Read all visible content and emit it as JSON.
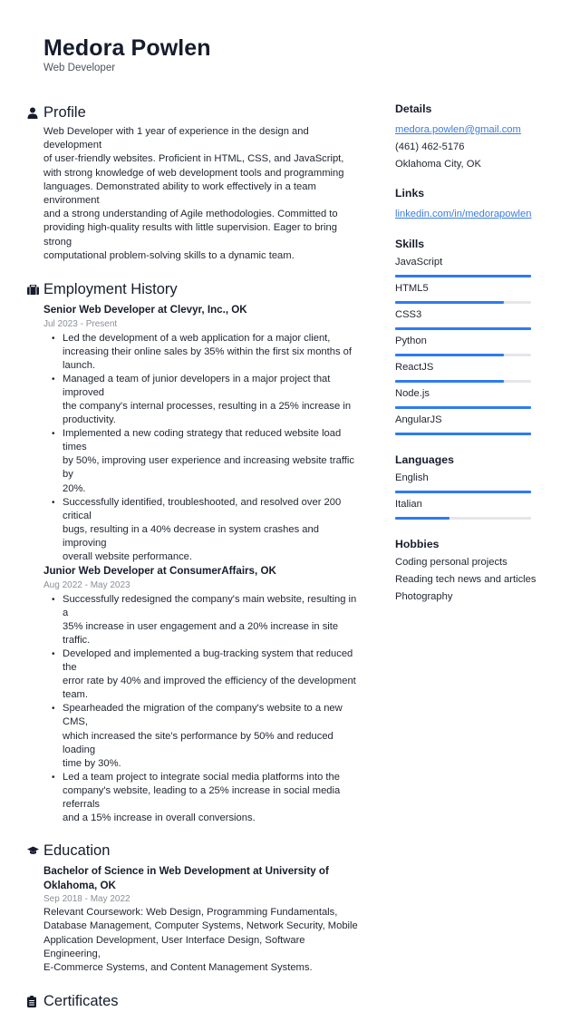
{
  "header": {
    "name": "Medora Powlen",
    "title": "Web Developer"
  },
  "profile": {
    "heading": "Profile",
    "icon": "person-icon",
    "lines": [
      "Web Developer with 1 year of experience in the design and development",
      "of user-friendly websites. Proficient in HTML, CSS, and JavaScript,",
      "with strong knowledge of web development tools and programming",
      "languages. Demonstrated ability to work effectively in a team environment",
      "and a strong understanding of Agile methodologies. Committed to",
      "providing high-quality results with little supervision. Eager to bring strong",
      "computational problem-solving skills to a dynamic team."
    ]
  },
  "employment": {
    "heading": "Employment History",
    "icon": "briefcase-icon",
    "jobs": [
      {
        "title": "Senior Web Developer at Clevyr, Inc., OK",
        "dates": "Jul 2023 - Present",
        "bullets": [
          [
            "Led the development of a web application for a major client,",
            "increasing their online sales by 35% within the first six months of",
            "launch."
          ],
          [
            "Managed a team of junior developers in a major project that improved",
            "the company's internal processes, resulting in a 25% increase in",
            "productivity."
          ],
          [
            "Implemented a new coding strategy that reduced website load times",
            "by 50%, improving user experience and increasing website traffic by",
            "20%."
          ],
          [
            "Successfully identified, troubleshooted, and resolved over 200 critical",
            "bugs, resulting in a 40% decrease in system crashes and improving",
            "overall website performance."
          ]
        ]
      },
      {
        "title": "Junior Web Developer at ConsumerAffairs, OK",
        "dates": "Aug 2022 - May 2023",
        "bullets": [
          [
            "Successfully redesigned the company's main website, resulting in a",
            "35% increase in user engagement and a 20% increase in site traffic."
          ],
          [
            "Developed and implemented a bug-tracking system that reduced the",
            "error rate by 40% and improved the efficiency of the development",
            "team."
          ],
          [
            "Spearheaded the migration of the company's website to a new CMS,",
            "which increased the site's performance by 50% and reduced loading",
            "time by 30%."
          ],
          [
            "Led a team project to integrate social media platforms into the",
            "company's website, leading to a 25% increase in social media referrals",
            "and a 15% increase in overall conversions."
          ]
        ]
      }
    ]
  },
  "education": {
    "heading": "Education",
    "icon": "graduation-cap-icon",
    "degree_lines": [
      "Bachelor of Science in Web Development at University of",
      "Oklahoma, OK"
    ],
    "dates": "Sep 2018 - May 2022",
    "lines": [
      "Relevant Coursework: Web Design, Programming Fundamentals,",
      "Database Management, Computer Systems, Network Security, Mobile",
      "Application Development, User Interface Design, Software Engineering,",
      "E-Commerce Systems, and Content Management Systems."
    ]
  },
  "certificates": {
    "heading": "Certificates",
    "icon": "clipboard-icon"
  },
  "details": {
    "heading": "Details",
    "email": "medora.powlen@gmail.com",
    "phone": "(461) 462-5176",
    "location": "Oklahoma City, OK"
  },
  "links": {
    "heading": "Links",
    "items": [
      "linkedin.com/in/medorapowlen"
    ]
  },
  "skills": {
    "heading": "Skills",
    "items": [
      {
        "name": "JavaScript",
        "level": 1.0
      },
      {
        "name": "HTML5",
        "level": 0.8
      },
      {
        "name": "CSS3",
        "level": 1.0
      },
      {
        "name": "Python",
        "level": 0.8
      },
      {
        "name": "ReactJS",
        "level": 0.8
      },
      {
        "name": "Node.js",
        "level": 1.0
      },
      {
        "name": "AngularJS",
        "level": 1.0
      }
    ]
  },
  "languages": {
    "heading": "Languages",
    "items": [
      {
        "name": "English",
        "level": 1.0
      },
      {
        "name": "Italian",
        "level": 0.4
      }
    ]
  },
  "hobbies": {
    "heading": "Hobbies",
    "items": [
      "Coding personal projects",
      "Reading tech news and articles",
      "Photography"
    ]
  },
  "colors": {
    "accent": "#2f7bf0",
    "track": "#e4e6ea",
    "link": "#3b7ddd",
    "text": "#1f2430",
    "muted": "#8a8f99"
  }
}
